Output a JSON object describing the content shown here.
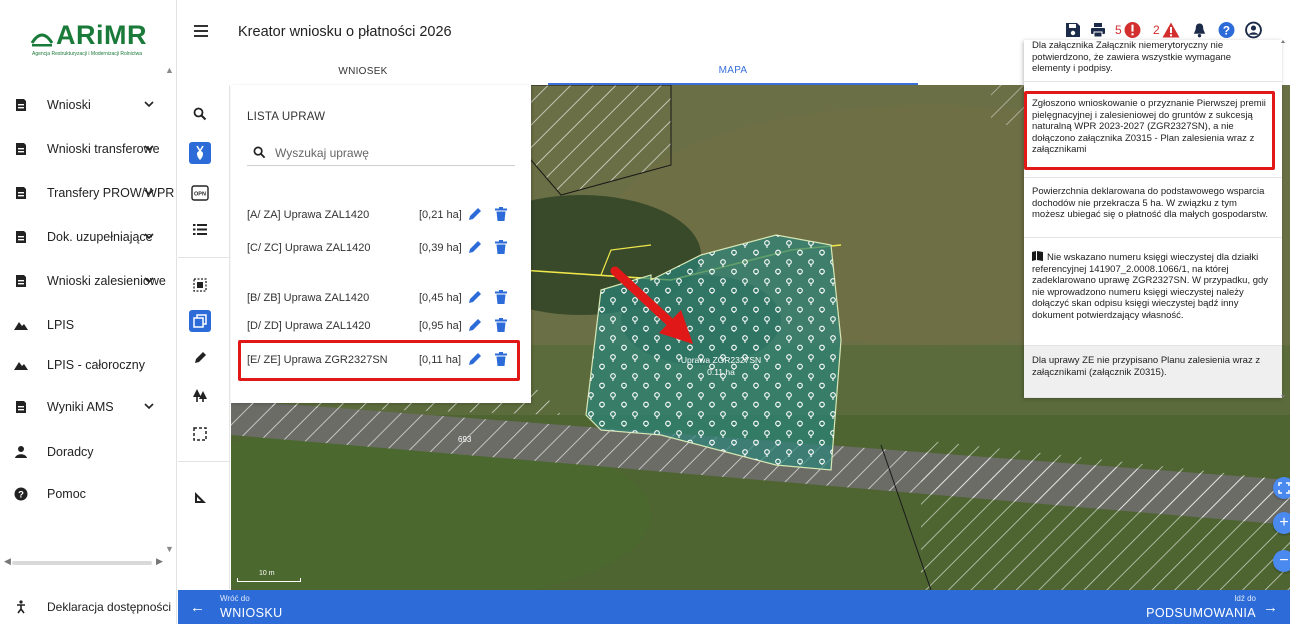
{
  "app": {
    "logo_text": "ARiMR",
    "logo_subtitle": "Agencja Restrukturyzacji i Modernizacji Rolnictwa",
    "title": "Kreator wniosku o płatności 2026"
  },
  "sidebar": {
    "items": [
      {
        "label": "Wnioski",
        "icon": "document-icon",
        "chevron": true
      },
      {
        "label": "Wnioski transferowe",
        "icon": "document-icon",
        "chevron": true
      },
      {
        "label": "Transfery PROW/WPR",
        "icon": "document-icon",
        "chevron": true
      },
      {
        "label": "Dok. uzupełniające",
        "icon": "document-icon",
        "chevron": true
      },
      {
        "label": "Wnioski zalesieniowe",
        "icon": "document-icon",
        "chevron": true
      },
      {
        "label": "LPIS",
        "icon": "mountain-icon",
        "chevron": false
      },
      {
        "label": "LPIS - całoroczny",
        "icon": "mountain-icon",
        "chevron": false
      },
      {
        "label": "Wyniki AMS",
        "icon": "document-icon",
        "chevron": true
      },
      {
        "label": "Doradcy",
        "icon": "person-icon",
        "chevron": false
      },
      {
        "label": "Pomoc",
        "icon": "help-icon",
        "chevron": false
      }
    ],
    "accessibility": "Deklaracja dostępności"
  },
  "header": {
    "error_count": "5",
    "warning_count": "2",
    "icons": [
      "save-icon",
      "print-icon",
      "error-icon",
      "warning-icon",
      "bell-icon",
      "help-icon",
      "user-icon"
    ],
    "accent_color": "#2d6cd8"
  },
  "tabs": {
    "wniosek": "WNIOSEK",
    "mapa": "MAPA",
    "active": "MAPA"
  },
  "crop_panel": {
    "title": "LISTA UPRAW",
    "search_placeholder": "Wyszukaj uprawę",
    "items": [
      {
        "name": "[A/ ZA] Uprawa ZAL1420",
        "area": "[0,21 ha]"
      },
      {
        "name": "[C/ ZC] Uprawa ZAL1420",
        "area": "[0,39 ha]"
      },
      {
        "name": "[B/ ZB] Uprawa ZAL1420",
        "area": "[0,45 ha]"
      },
      {
        "name": "[D/ ZD] Uprawa ZAL1420",
        "area": "[0,95 ha]"
      },
      {
        "name": "[E/ ZE] Uprawa ZGR2327SN",
        "area": "[0,11 ha]"
      }
    ]
  },
  "notifications": [
    {
      "text": "Dla załącznika Załącznik niemerytoryczny nie potwierdzono, że zawiera wszystkie wymagane elementy i podpisy."
    },
    {
      "text": "Zgłoszono wnioskowanie o przyznanie Pierwszej premii pielęgnacyjnej i zalesieniowej do gruntów z sukcesją naturalną WPR 2023-2027 (ZGR2327SN), a nie dołączono załącznika Z0315 - Plan zalesienia wraz z załącznikami"
    },
    {
      "text": "Powierzchnia deklarowana do podstawowego wsparcia dochodów nie przekracza 5 ha. W związku z tym możesz ubiegać się o płatność dla małych gospodarstw."
    },
    {
      "text": "Nie wskazano numeru księgi wieczystej dla działki referencyjnej 141907_2.0008.1066/1, na której zadeklarowano uprawę ZGR2327SN. W przypadku, gdy nie wprowadzono numeru księgi wieczystej należy dołączyć skan odpisu księgi wieczystej bądź inny dokument potwierdzający własność."
    },
    {
      "text": "Dla uprawy ZE nie przypisano Planu zalesienia wraz z załącznikami (załącznik Z0315)."
    }
  ],
  "map": {
    "parcel_label": "Uprawa ZGR2327SN",
    "parcel_area": "0.11 ha",
    "plot_number": "693",
    "scale_label": "10 m"
  },
  "bottom_bar": {
    "back_small": "Wróć do",
    "back_big": "WNIOSKU",
    "next_small": "Idź do",
    "next_big": "PODSUMOWANIA"
  }
}
